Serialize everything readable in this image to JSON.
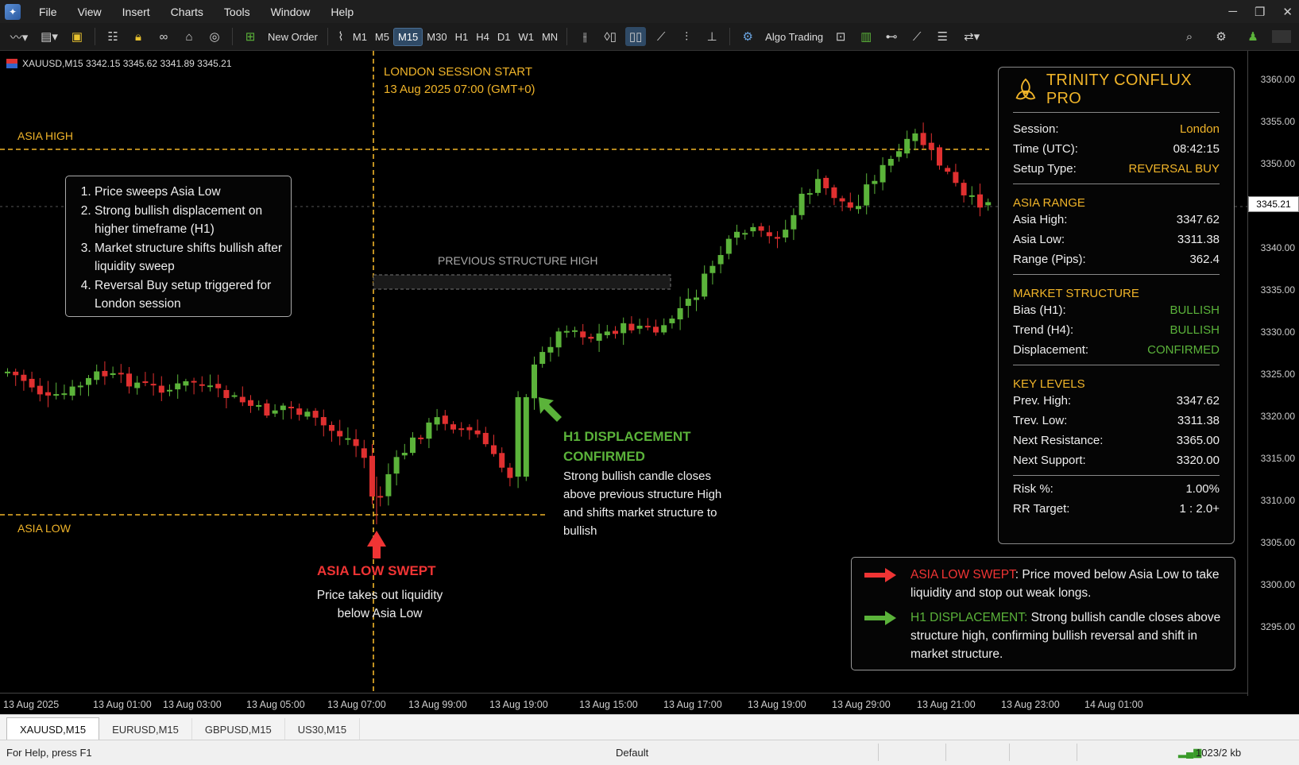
{
  "menu": [
    "File",
    "View",
    "Insert",
    "Charts",
    "Tools",
    "Window",
    "Help"
  ],
  "toolbar": {
    "new_order": "New Order",
    "timeframes": [
      "M1",
      "M5",
      "M15",
      "M30",
      "H1",
      "H4",
      "D1",
      "W1",
      "MN"
    ],
    "active_timeframe": "M15",
    "algo_trading": "Algo Trading"
  },
  "symbol_info": "XAUUSD,M15  3342.15  3345.62  3341.89  3345.21",
  "chart": {
    "asia_high_label": "ASIA HIGH",
    "asia_low_label": "ASIA LOW",
    "session_title": "LONDON SESSION START",
    "session_time": "13 Aug 2025 07:00 (GMT+0)",
    "prev_structure_label": "PREVIOUS STRUCTURE HIGH",
    "steps": [
      "Price sweeps Asia Low",
      "Strong bullish displacement on higher timeframe (H1)",
      "Market structure shifts bullish after liquidity sweep",
      "Reversal Buy setup triggered for London session"
    ],
    "swept_title": "ASIA LOW SWEPT",
    "swept_desc": "Price takes out liquidity below Asia Low",
    "disp_title": "H1 DISPLACEMENT CONFIRMED",
    "disp_desc": "Strong bullish candle closes above previous structure High and shifts market structure to bullish",
    "current_price": "3345.21",
    "price_labels": [
      "3360.00",
      "3355.00",
      "3350.00",
      "3345.00",
      "3340.00",
      "3335.00",
      "3330.00",
      "3325.00",
      "3320.00",
      "3315.00",
      "3310.00",
      "3305.00",
      "3300.00",
      "3295.00"
    ],
    "time_labels": [
      "13 Aug 2025",
      "13 Aug 01:00",
      "13 Aug 03:00",
      "13 Aug 05:00",
      "13 Aug 07:00",
      "13 Aug 99:00",
      "13 Aug 19:00",
      "13 Aug 15:00",
      "13 Aug 17:00",
      "13 Aug 19:00",
      "13 Aug 29:00",
      "13 Aug 21:00",
      "13 Aug 23:00",
      "14 Aug 01:00"
    ],
    "colors": {
      "bull": "#5bb33a",
      "bear": "#e03030",
      "level": "#f0b429"
    }
  },
  "panel": {
    "title": "TRINITY CONFLUX PRO",
    "rows1": [
      {
        "label": "Session:",
        "value": "London"
      },
      {
        "label": "Time (UTC):",
        "value": "08:42:15"
      },
      {
        "label": "Setup Type:",
        "value": "REVERSAL BUY"
      }
    ],
    "asia_range_title": "ASIA RANGE",
    "asia_range": [
      {
        "label": "Asia High:",
        "value": "3347.62"
      },
      {
        "label": "Asia Low:",
        "value": "3311.38"
      },
      {
        "label": "Range (Pips):",
        "value": "362.4"
      }
    ],
    "structure_title": "MARKET STRUCTURE",
    "structure": [
      {
        "label": "Bias (H1):",
        "value": "BULLISH"
      },
      {
        "label": "Trend (H4):",
        "value": "BULLISH"
      },
      {
        "label": "Displacement:",
        "value": "CONFIRMED"
      }
    ],
    "levels_title": "KEY LEVELS",
    "levels": [
      {
        "label": "Prev. High:",
        "value": "3347.62"
      },
      {
        "label": "Trev. Low:",
        "value": "3311.38"
      },
      {
        "label": "Next Resistance:",
        "value": "3365.00"
      },
      {
        "label": "Next Support:",
        "value": "3320.00"
      }
    ],
    "risk": [
      {
        "label": "Risk %:",
        "value": "1.00%"
      },
      {
        "label": "RR Target:",
        "value": "1 : 2.0+"
      }
    ]
  },
  "legend": {
    "swept_head": "ASIA LOW SWEPT",
    "swept_text": ": Price moved below Asia Low to take liquidity and stop out weak longs.",
    "disp_head": "H1 DISPLACEMENT:",
    "disp_text": " Strong bullish candle closes above structure high, confirming bullish reversal and shift in market structure."
  },
  "tabs": [
    "XAUUSD,M15",
    "EURUSD,M15",
    "GBPUSD,M15",
    "US30,M15"
  ],
  "status": {
    "help": "For Help, press F1",
    "profile": "Default",
    "traffic": "1023/2 kb"
  }
}
